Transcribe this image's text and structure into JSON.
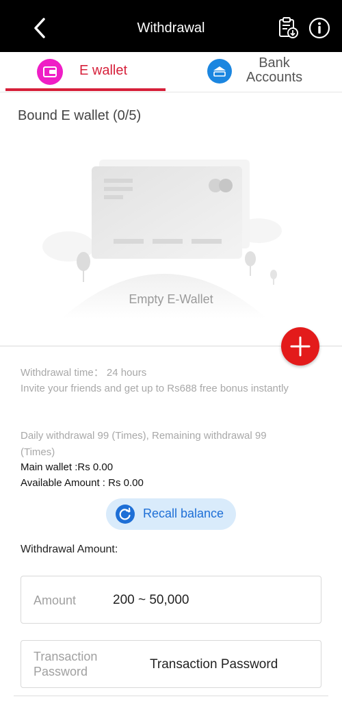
{
  "header": {
    "title": "Withdrawal",
    "back_icon": "chevron-left-icon",
    "records_icon": "clipboard-download-icon",
    "info_icon": "info-icon"
  },
  "tabs": [
    {
      "label": "E wallet",
      "icon": "wallet-icon",
      "active": true,
      "color": "#ef1ec6"
    },
    {
      "label": "Bank Accounts",
      "icon": "bank-card-icon",
      "active": false,
      "color": "#1b86e0"
    }
  ],
  "bound": {
    "title": "Bound E wallet (0/5)",
    "empty_text": "Empty E-Wallet"
  },
  "add_button_icon": "plus-icon",
  "info": {
    "withdrawal_time": "Withdrawal time：  24 hours",
    "invite": "Invite your friends and get up to Rs688 free bonus instantly",
    "daily_line1": "Daily withdrawal 99 (Times), Remaining withdrawal 99",
    "daily_line2": "(Times)",
    "main_wallet": "Main wallet :Rs 0.00",
    "available": "Available Amount : Rs 0.00"
  },
  "recall": {
    "label": "Recall balance",
    "icon": "refresh-icon"
  },
  "form": {
    "amount_section_label": "Withdrawal Amount:",
    "amount_label": "Amount",
    "amount_placeholder": "200 ~ 50,000",
    "password_label_line1": "Transaction",
    "password_label_line2": "Password",
    "password_placeholder": "Transaction Password"
  },
  "colors": {
    "accent": "#d6203a",
    "add": "#e31b1b",
    "recall_bg": "#d9ebfb",
    "recall_fg": "#1e6fd6"
  }
}
